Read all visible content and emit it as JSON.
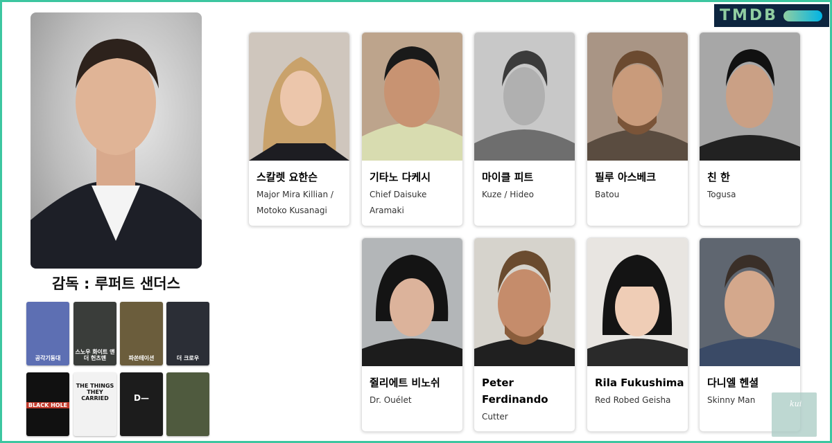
{
  "logo": {
    "text": "TMDB"
  },
  "director": {
    "caption": "감독 : 루퍼트 샌더스"
  },
  "filmography_posters": [
    {
      "caption": "공각기동대",
      "bg": "#5d6fb3"
    },
    {
      "caption": "스노우 화이트 앤 더 헌츠맨",
      "bg": "#3a3d3a"
    },
    {
      "caption": "파쏜테이션",
      "bg": "#6b5d3c"
    },
    {
      "caption": "더 크로우",
      "bg": "#2b2e36"
    },
    {
      "caption": "BLACK HOLE",
      "bg": "#111111"
    },
    {
      "caption": "THE THINGS THEY CARRIED",
      "bg": "#f2f2f2"
    },
    {
      "caption": "D—",
      "bg": "#1c1c1c"
    },
    {
      "caption": "",
      "bg": "#4f5a3e"
    }
  ],
  "cast": [
    {
      "name": "스칼렛 요한슨",
      "role": "Major Mira Killian / Motoko Kusanagi"
    },
    {
      "name": "기타노 다케시",
      "role": "Chief Daisuke Aramaki"
    },
    {
      "name": "마이클 피트",
      "role": "Kuze / Hideo"
    },
    {
      "name": "필루 아스베크",
      "role": "Batou"
    },
    {
      "name": "친 한",
      "role": "Togusa"
    },
    {
      "name": "쥘리에트 비노쉬",
      "role": "Dr. Ouélet"
    },
    {
      "name": "Peter Ferdinando",
      "role": "Cutter"
    },
    {
      "name": "Rila Fukushima",
      "role": "Red Robed Geisha"
    },
    {
      "name": "다니엘 헨셜",
      "role": "Skinny Man"
    }
  ],
  "watermark": {
    "text": "kui"
  }
}
